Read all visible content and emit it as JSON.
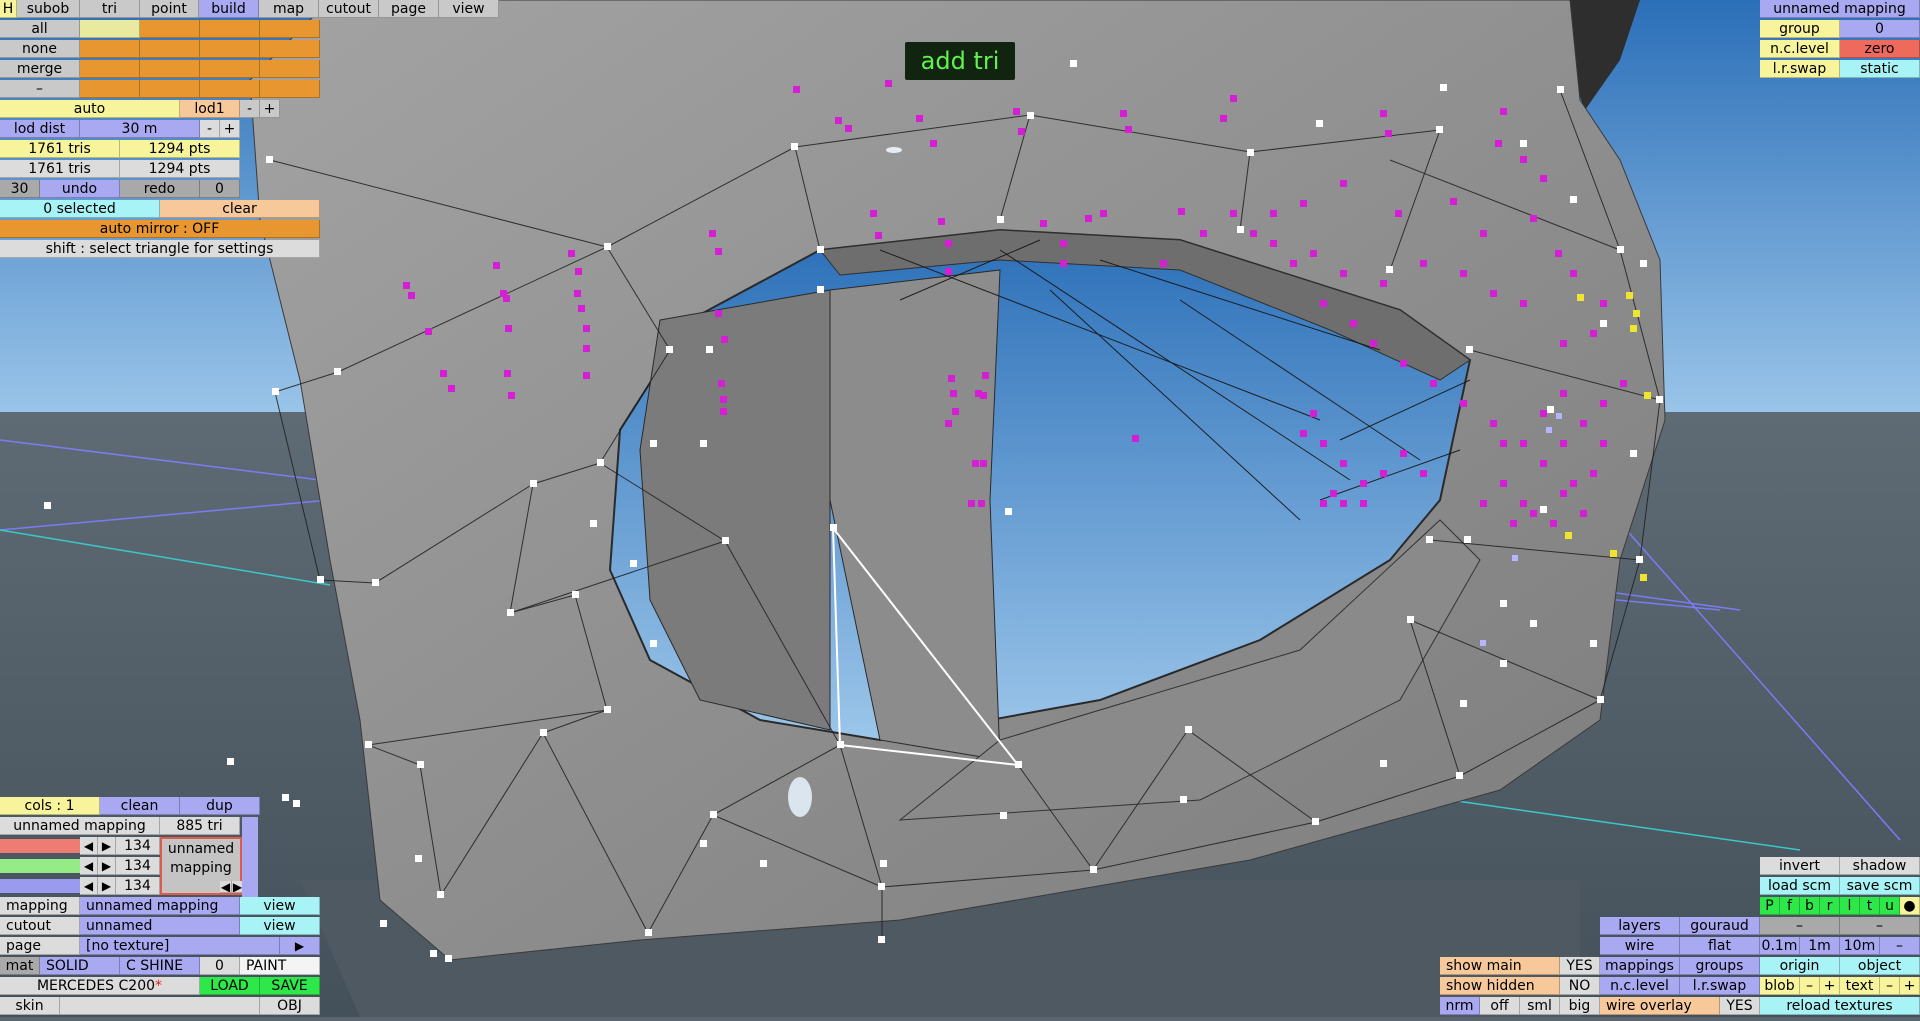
{
  "toolbar": {
    "tabs": [
      "H",
      "subob",
      "tri",
      "point",
      "build",
      "map",
      "cutout",
      "page",
      "view"
    ]
  },
  "select_panel": {
    "rows": [
      "all",
      "none",
      "merge",
      "–"
    ],
    "auto": "auto",
    "lod": "lod1",
    "lod_minus": "-",
    "lod_plus": "+",
    "lod_dist_label": "lod dist",
    "lod_dist_value": "30 m",
    "tris_1": "1761 tris",
    "pts_1": "1294 pts",
    "tris_2": "1761 tris",
    "pts_2": "1294 pts",
    "undo_count": "30",
    "undo": "undo",
    "redo": "redo",
    "redo_count": "0",
    "selected": "0 selected",
    "clear": "clear",
    "auto_mirror": "auto mirror : OFF",
    "hint": "shift : select triangle for settings"
  },
  "viewport": {
    "mode_label": "add tri"
  },
  "mapping_panel": {
    "title": "unnamed mapping",
    "group_label": "group",
    "group_value": "0",
    "nc_level_label": "n.c.level",
    "nc_level_value": "zero",
    "lr_swap_label": "l.r.swap",
    "lr_swap_value": "static"
  },
  "material_panel": {
    "cols": "cols : 1",
    "clean": "clean",
    "dup": "dup",
    "mapping_name": "unnamed mapping",
    "tri_count": "885 tri",
    "channel_values": [
      "134",
      "134",
      "134"
    ],
    "preview_label": "unnamed mapping",
    "mapping_label": "mapping",
    "mapping_value": "unnamed mapping",
    "mapping_view": "view",
    "cutout_label": "cutout",
    "cutout_value": "unnamed",
    "cutout_view": "view",
    "page_label": "page",
    "page_value": "[no texture]",
    "mat_label": "mat",
    "solid": "SOLID",
    "c_shine": "C SHINE",
    "shine_value": "0",
    "paint": "PAINT",
    "car_name": "MERCEDES C200",
    "car_modified": "*",
    "load": "LOAD",
    "save": "SAVE",
    "skin": "skin",
    "obj": "OBJ"
  },
  "view_panel": {
    "invert": "invert",
    "shadow": "shadow",
    "load_scm": "load scm",
    "save_scm": "save scm",
    "flags": [
      "P",
      "f",
      "b",
      "r",
      "l",
      "t",
      "u",
      "●"
    ],
    "layers": "layers",
    "gouraud": "gouraud",
    "dash1": "–",
    "dash2": "–",
    "wire": "wire",
    "flat": "flat",
    "dist_01": "0.1m",
    "dist_1": "1m",
    "dist_10": "10m",
    "dist_dash": "–",
    "show_main": "show main",
    "show_main_value": "YES",
    "mappings": "mappings",
    "groups": "groups",
    "origin": "origin",
    "object": "object",
    "show_hidden": "show hidden",
    "show_hidden_value": "NO",
    "nc_level": "n.c.level",
    "lr_swap": "l.r.swap",
    "blob": "blob",
    "blob_minus": "–",
    "blob_plus": "+",
    "text": "text",
    "text_minus": "–",
    "text_plus": "+",
    "nrm": "nrm",
    "off": "off",
    "sml": "sml",
    "big": "big",
    "wire_overlay": "wire overlay",
    "wire_overlay_value": "YES",
    "reload_textures": "reload textures"
  }
}
